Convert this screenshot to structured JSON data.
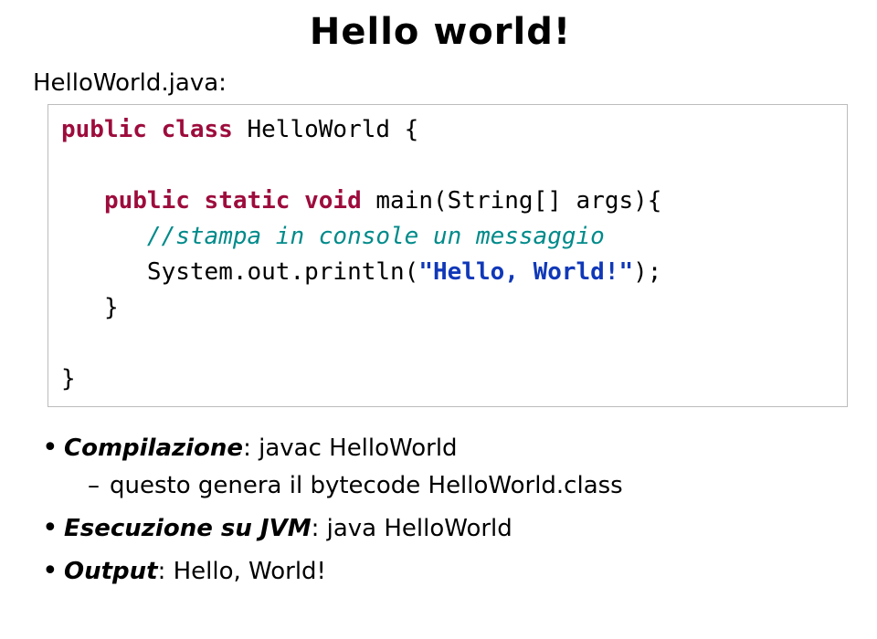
{
  "title": "Hello world!",
  "filename": "HelloWorld.java:",
  "code": {
    "l1_kw": "public class ",
    "l1_rest": "HelloWorld {",
    "l2_indent": "   ",
    "l2_kw": "public static void ",
    "l2_rest": "main(String[] args){",
    "l3_indent": "      ",
    "l3_comment": "//stampa in console un messaggio",
    "l4_indent": "      ",
    "l4_pre": "System.out.println(",
    "l4_str": "\"Hello, World!\"",
    "l4_post": ");",
    "l5": "   }",
    "l6": "}"
  },
  "bullets": [
    {
      "label": "Compilazione",
      "rest": ": javac HelloWorld",
      "sub": "questo genera il bytecode HelloWorld.class"
    },
    {
      "label": "Esecuzione su JVM",
      "rest": ": java HelloWorld"
    },
    {
      "label": "Output",
      "rest": ": Hello, World!"
    }
  ]
}
